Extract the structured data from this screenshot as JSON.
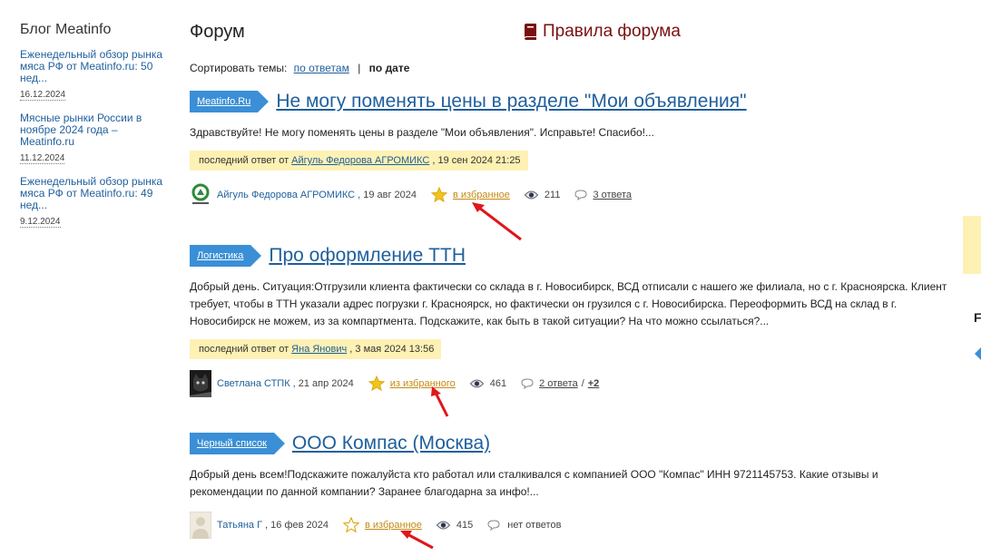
{
  "sidebar": {
    "title": "Блог Meatinfo",
    "items": [
      {
        "title": "Еженедельный обзор рынка мяса РФ от Meatinfo.ru: 50 нед...",
        "date": "16.12.2024"
      },
      {
        "title": "Мясные рынки России в ноябре 2024 года – Meatinfo.ru",
        "date": "11.12.2024"
      },
      {
        "title": "Еженедельный обзор рынка мяса РФ от Meatinfo.ru: 49 нед...",
        "date": "9.12.2024"
      }
    ]
  },
  "header": {
    "title": "Форум",
    "rules_label": "Правила форума"
  },
  "sort": {
    "label": "Сортировать темы:",
    "by_replies": "по ответам",
    "separator": "|",
    "by_date": "по дате"
  },
  "topics": [
    {
      "category": "Meatinfo.Ru",
      "title": "Не могу поменять цены в разделе \"Мои объявления\"",
      "excerpt": "Здравствуйте! Не могу поменять цены в разделе \"Мои объявления\". Исправьте!   Спасибо!...",
      "last_reply_prefix": "последний ответ от",
      "last_reply_author": "Айгуль Федорова АГРОМИКС",
      "last_reply_date": ", 19 сен 2024 21:25",
      "author": "Айгуль Федорова АГРОМИКС",
      "date": ", 19 авг 2024",
      "fav_label": "в избранное",
      "views": "211",
      "comments": "3 ответа",
      "avatar_icon": "agromix-logo-icon"
    },
    {
      "category": "Логистика",
      "title": "Про оформление ТТН",
      "excerpt": "Добрый день. Ситуация:Отгрузили клиента фактически со склада в г. Новосибирск, ВСД отписали с нашего же филиала, но с г. Красноярска. Клиент требует, чтобы в ТТН указали адрес погрузки г. Красноярск, но фактически он грузился с г. Новосибирска. Переоформить ВСД на склад в г. Новосибирск не можем, из за компартмента. Подскажите, как быть в такой ситуации? На что можно ссылаться?...",
      "last_reply_prefix": "последний ответ от",
      "last_reply_author": "Яна Янович",
      "last_reply_date": ", 3 мая 2024 13:56",
      "author": "Светлана СТПК",
      "date": ", 21 апр 2024",
      "fav_label": "из избранного",
      "views": "461",
      "comments": "2 ответа",
      "comments_sep": "/",
      "comments_plus": "+2",
      "avatar_icon": "cat-photo-icon"
    },
    {
      "category": "Черный список",
      "title": "ООО Компас (Москва)",
      "excerpt": "Добрый день всем!Подскажите пожалуйста кто работал или сталкивался с компанией ООО \"Компас\" ИНН 9721145753. Какие отзывы и рекомендации по данной компании? Заранее благодарна за инфо!...",
      "author": "Татьяна Г",
      "date": ", 16 фев 2024",
      "fav_label": "в избранное",
      "views": "415",
      "comments": "нет ответов",
      "avatar_icon": "person-placeholder-icon"
    }
  ],
  "colors": {
    "link": "#1f5f9c",
    "category": "#3a8fd6",
    "highlight": "#fdf1b4",
    "star": "#f0c419",
    "rules": "#7a1010",
    "arrow": "#e0161b"
  },
  "right_edge": {
    "letter": "F"
  }
}
